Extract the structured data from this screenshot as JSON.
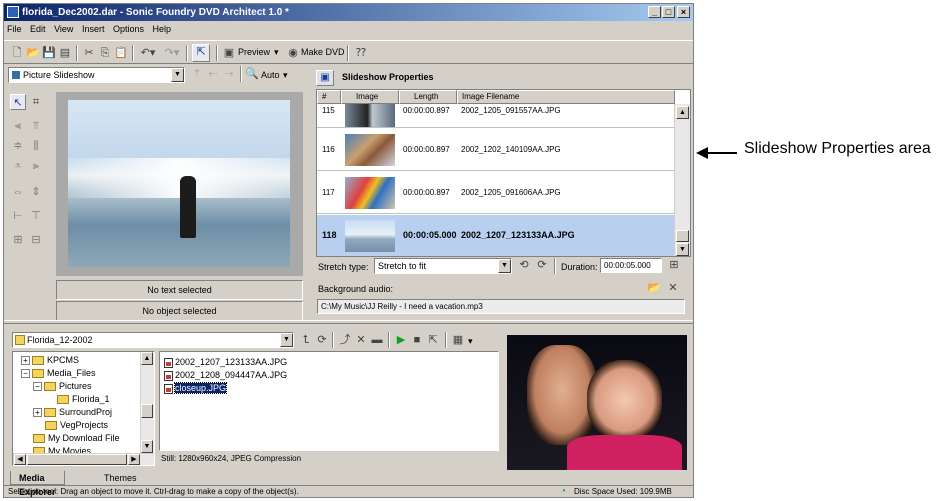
{
  "window": {
    "title": "florida_Dec2002.dar - Sonic Foundry DVD Architect 1.0 *",
    "controls": [
      "_",
      "□",
      "×"
    ]
  },
  "menu": [
    "File",
    "Edit",
    "View",
    "Insert",
    "Options",
    "Help"
  ],
  "toolbar": {
    "preview_label": "Preview",
    "make_dvd_label": "Make DVD"
  },
  "editor": {
    "dropdown_value": "Picture Slideshow",
    "zoom_label": "Auto",
    "no_text": "No text selected",
    "no_object": "No object selected"
  },
  "slideshow": {
    "panel_title": "Slideshow Properties",
    "columns": [
      "#",
      "Image",
      "Length",
      "Image Filename"
    ],
    "rows": [
      {
        "num": "115",
        "length": "00:00:00.897",
        "filename": "2002_1205_091557AA.JPG"
      },
      {
        "num": "116",
        "length": "00:00:00.897",
        "filename": "2002_1202_140109AA.JPG"
      },
      {
        "num": "117",
        "length": "00:00:00.897",
        "filename": "2002_1205_091606AA.JPG"
      },
      {
        "num": "118",
        "length": "00:00:05.000",
        "filename": "2002_1207_123133AA.JPG"
      }
    ],
    "stretch_label": "Stretch type:",
    "stretch_value": "Stretch to fit",
    "duration_label": "Duration:",
    "duration_value": "00:00:05.000",
    "bg_audio_label": "Background audio:",
    "bg_audio_value": "C:\\My Music\\JJ Reilly - I need a vacation.mp3"
  },
  "explorer": {
    "folder_value": "Florida_12-2002",
    "tree": [
      {
        "label": "KPCMS",
        "pm": "+"
      },
      {
        "label": "Media_Files",
        "pm": "−"
      },
      {
        "label": "Pictures",
        "pm": "−"
      },
      {
        "label": "Florida_1",
        "pm": ""
      },
      {
        "label": "SurroundProj",
        "pm": "+"
      },
      {
        "label": "VegProjects",
        "pm": ""
      },
      {
        "label": "My Download File",
        "pm": ""
      },
      {
        "label": "My Movies",
        "pm": ""
      }
    ],
    "files": [
      {
        "name": "2002_1207_123133AA.JPG",
        "selected": false
      },
      {
        "name": "2002_1208_094447AA.JPG",
        "selected": false
      },
      {
        "name": "closeup.JPG",
        "selected": true
      }
    ],
    "file_info": "Still: 1280x960x24, JPEG Compression",
    "tabs": [
      "Media Explorer",
      "Themes"
    ]
  },
  "status": {
    "hint": "Selection tool: Drag an object to move it.  Ctrl-drag to make a copy of the object(s).",
    "disc_space": "Disc Space Used: 109.9MB"
  },
  "callout": {
    "text": "Slideshow Properties area"
  }
}
